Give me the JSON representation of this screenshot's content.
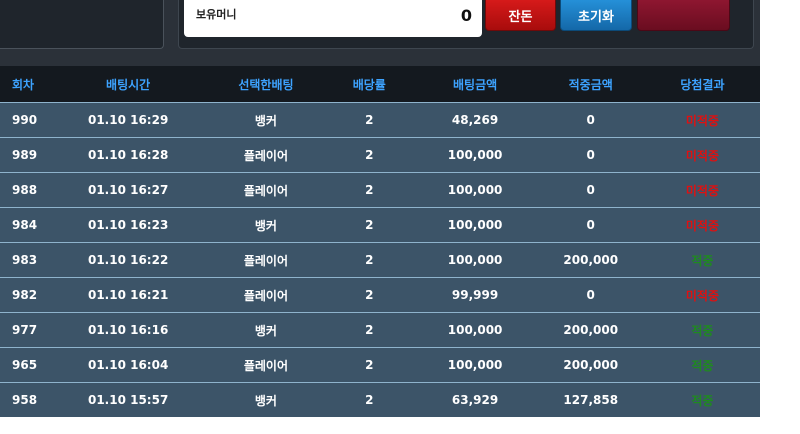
{
  "balance": {
    "label": "보유머니",
    "amount": "0"
  },
  "buttons": {
    "stop": "잔돈",
    "reset": "초기화",
    "extra": ""
  },
  "table": {
    "headers": [
      "회차",
      "배팅시간",
      "선택한배팅",
      "배당률",
      "배팅금액",
      "적중금액",
      "당첨결과"
    ],
    "rows": [
      {
        "round": "990",
        "time": "01.10 16:29",
        "pick": "뱅커",
        "odds": "2",
        "bet": "48,269",
        "win": "0",
        "result": "미적중",
        "status": "lose"
      },
      {
        "round": "989",
        "time": "01.10 16:28",
        "pick": "플레이어",
        "odds": "2",
        "bet": "100,000",
        "win": "0",
        "result": "미적중",
        "status": "lose"
      },
      {
        "round": "988",
        "time": "01.10 16:27",
        "pick": "플레이어",
        "odds": "2",
        "bet": "100,000",
        "win": "0",
        "result": "미적중",
        "status": "lose"
      },
      {
        "round": "984",
        "time": "01.10 16:23",
        "pick": "뱅커",
        "odds": "2",
        "bet": "100,000",
        "win": "0",
        "result": "미적중",
        "status": "lose"
      },
      {
        "round": "983",
        "time": "01.10 16:22",
        "pick": "플레이어",
        "odds": "2",
        "bet": "100,000",
        "win": "200,000",
        "result": "적중",
        "status": "win"
      },
      {
        "round": "982",
        "time": "01.10 16:21",
        "pick": "플레이어",
        "odds": "2",
        "bet": "99,999",
        "win": "0",
        "result": "미적중",
        "status": "lose"
      },
      {
        "round": "977",
        "time": "01.10 16:16",
        "pick": "뱅커",
        "odds": "2",
        "bet": "100,000",
        "win": "200,000",
        "result": "적중",
        "status": "win"
      },
      {
        "round": "965",
        "time": "01.10 16:04",
        "pick": "플레이어",
        "odds": "2",
        "bet": "100,000",
        "win": "200,000",
        "result": "적중",
        "status": "win"
      },
      {
        "round": "958",
        "time": "01.10 15:57",
        "pick": "뱅커",
        "odds": "2",
        "bet": "63,929",
        "win": "127,858",
        "result": "적중",
        "status": "win"
      }
    ]
  },
  "colors": {
    "header_text": "#3da3ff",
    "row_bg": "#3c5468",
    "lose": "#e01010",
    "win": "#1f8a1f"
  }
}
